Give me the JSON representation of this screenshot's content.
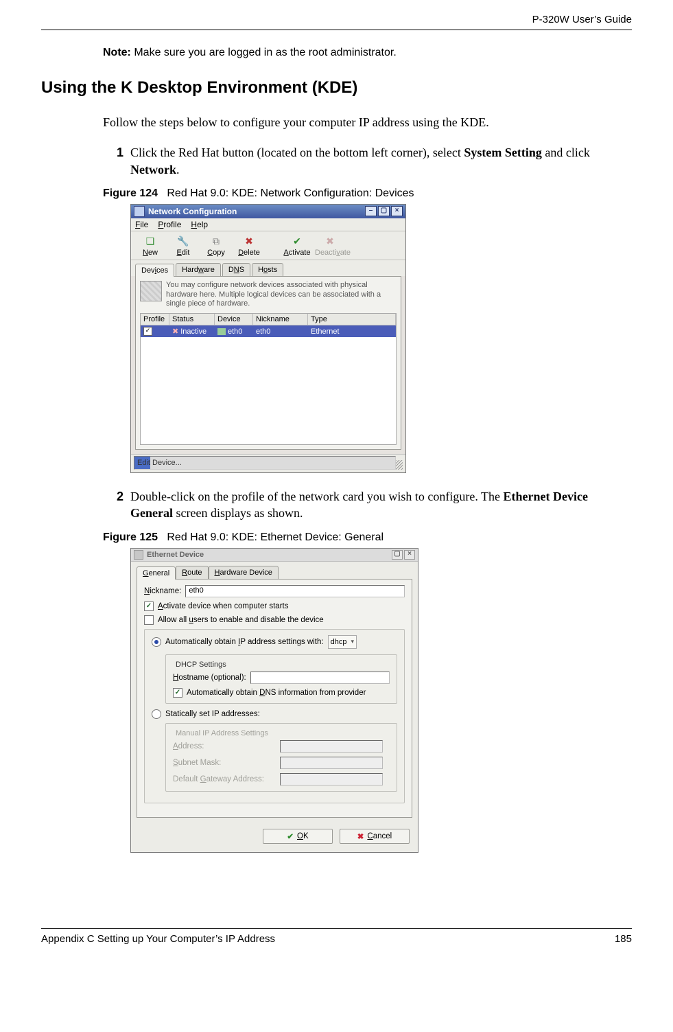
{
  "header": {
    "doc_title": "P-320W User’s Guide"
  },
  "note": {
    "label": "Note:",
    "text": "Make sure you are logged in as the root administrator."
  },
  "section_heading": "Using the K Desktop Environment (KDE)",
  "intro_para": "Follow the steps below to configure your computer IP address using the KDE.",
  "step1": {
    "num": "1",
    "pre": "Click the Red Hat button (located on the bottom left corner), select ",
    "bold1": "System Setting",
    "mid": " and click ",
    "bold2": "Network",
    "post": "."
  },
  "fig124": {
    "label": "Figure 124",
    "caption": "Red Hat 9.0: KDE: Network Configuration: Devices"
  },
  "shot1": {
    "title": "Network Configuration",
    "menu": {
      "file": "File",
      "profile": "Profile",
      "help": "Help"
    },
    "toolbar": {
      "new": "New",
      "edit": "Edit",
      "copy": "Copy",
      "delete": "Delete",
      "activate": "Activate",
      "deactivate": "Deactivate"
    },
    "tabs": {
      "devices": "Devices",
      "hardware": "Hardware",
      "dns": "DNS",
      "hosts": "Hosts"
    },
    "blurb": "You may configure network devices associated with physical hardware here.  Multiple logical devices can be associated with a single piece of hardware.",
    "cols": {
      "profile": "Profile",
      "status": "Status",
      "device": "Device",
      "nickname": "Nickname",
      "type": "Type"
    },
    "row": {
      "checked": "✓",
      "status": "Inactive",
      "device": "eth0",
      "nickname": "eth0",
      "type": "Ethernet"
    },
    "statusbar": "Edit Device..."
  },
  "step2": {
    "num": "2",
    "pre": "Double-click on the profile of the network card you wish to configure. The ",
    "bold1": "Ethernet Device General",
    "post": " screen displays as shown."
  },
  "fig125": {
    "label": "Figure 125",
    "caption": "Red Hat 9.0: KDE: Ethernet Device: General"
  },
  "shot2": {
    "title": "Ethernet Device",
    "tabs": {
      "general": "General",
      "route": "Route",
      "hardware": "Hardware Device"
    },
    "nickname_label": "Nickname:",
    "nickname_value": "eth0",
    "activate_label": "Activate device when computer starts",
    "allow_label": "Allow all users to enable and disable the device",
    "auto_ip_label": "Automatically obtain IP address settings with:",
    "dhcp": "dhcp",
    "dhcp_legend": "DHCP Settings",
    "hostname_label": "Hostname (optional):",
    "auto_dns_label": "Automatically obtain DNS information from provider",
    "static_label": "Statically set IP addresses:",
    "manual_legend": "Manual IP Address Settings",
    "address_label": "Address:",
    "subnet_label": "Subnet Mask:",
    "gateway_label": "Default Gateway Address:",
    "ok": "OK",
    "cancel": "Cancel"
  },
  "footer": {
    "left": "Appendix C Setting up Your Computer’s IP Address",
    "right": "185"
  }
}
